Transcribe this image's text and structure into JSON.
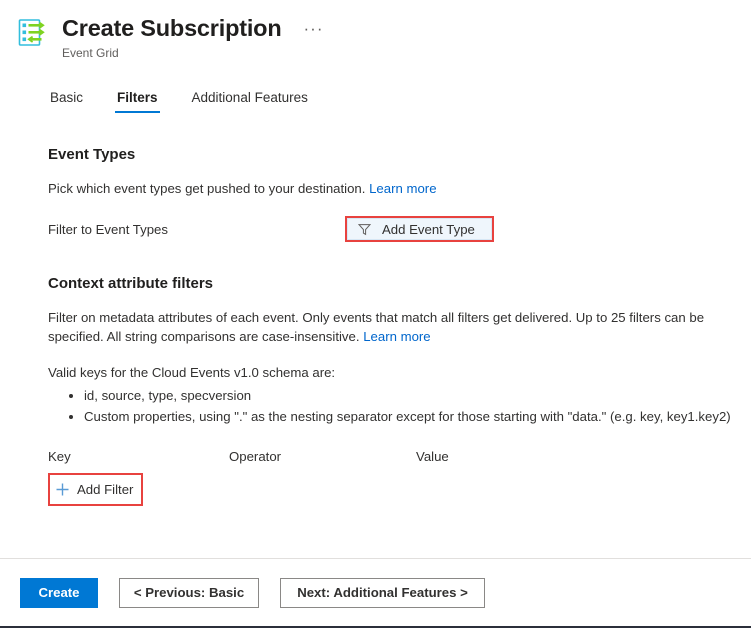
{
  "header": {
    "icon": "event-grid-icon",
    "title": "Create Subscription",
    "subtitle": "Event Grid",
    "more_label": "···"
  },
  "tabs": [
    {
      "label": "Basic",
      "active": false
    },
    {
      "label": "Filters",
      "active": true
    },
    {
      "label": "Additional Features",
      "active": false
    }
  ],
  "event_types": {
    "section_title": "Event Types",
    "description": "Pick which event types get pushed to your destination.",
    "learn_more": "Learn more",
    "filter_label": "Filter to Event Types",
    "add_button": {
      "label": "Add Event Type",
      "icon": "funnel-icon",
      "highlight_color": "#e8423f",
      "background": "#eff6fc"
    }
  },
  "context_filters": {
    "section_title": "Context attribute filters",
    "description": "Filter on metadata attributes of each event. Only events that match all filters get delivered. Up to 25 filters can be specified. All string comparisons are case-insensitive.",
    "learn_more": "Learn more",
    "valid_keys_intro": "Valid keys for the Cloud Events v1.0 schema are:",
    "bullets": [
      "id, source, type, specversion",
      "Custom properties, using \".\" as the nesting separator except for those starting with \"data.\" (e.g. key, key1.key2)"
    ],
    "columns": [
      "Key",
      "Operator",
      "Value"
    ],
    "add_filter": {
      "label": "Add Filter",
      "icon": "plus-icon",
      "highlight_color": "#e8423f",
      "icon_color": "#5a9bd5"
    }
  },
  "footer": {
    "create_label": "Create",
    "previous_label": "< Previous: Basic",
    "next_label": "Next: Additional Features >",
    "primary_color": "#0078d4"
  }
}
